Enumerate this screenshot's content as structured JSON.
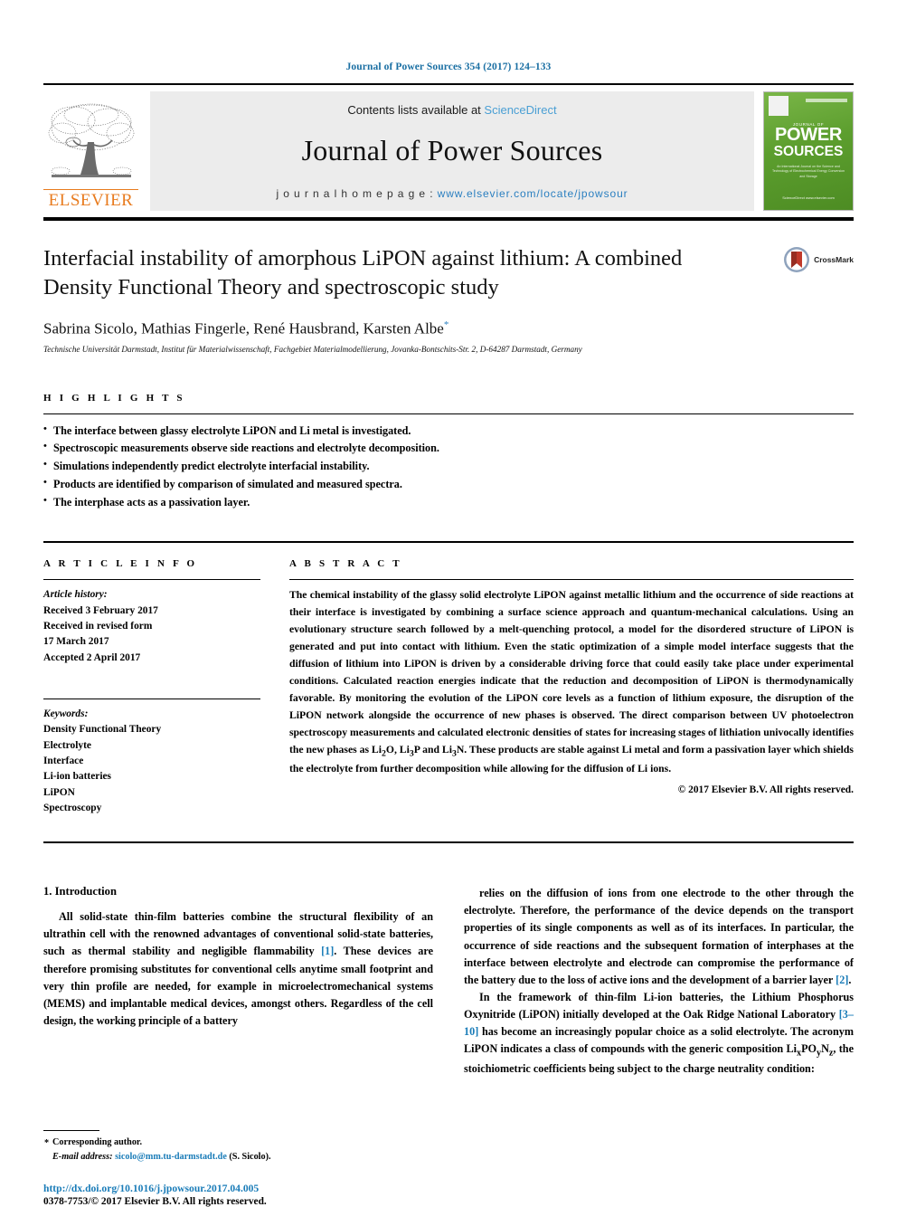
{
  "running_head": "Journal of Power Sources 354 (2017) 124–133",
  "masthead": {
    "contents_prefix": "Contents lists available at ",
    "sciencedirect": "ScienceDirect",
    "journal_name": "Journal of Power Sources",
    "homepage_prefix": "j o u r n a l   h o m e p a g e :  ",
    "homepage_url": "www.elsevier.com/locate/jpowsour",
    "publisher_logo_text": "ELSEVIER",
    "cover": {
      "kicker": "JOURNAL OF",
      "title_line1": "POWER",
      "title_line2": "SOURCES",
      "subtitle": "An International Journal on the Science and Technology of Electrochemical Energy Conversion and Storage",
      "footer": "ScienceDirect\nwww.elsevier.com"
    }
  },
  "article": {
    "title": "Interfacial instability of amorphous LiPON against lithium: A combined Density Functional Theory and spectroscopic study",
    "authors": "Sabrina Sicolo, Mathias Fingerle, René Hausbrand, Karsten Albe",
    "corresponding_marker": "*",
    "affiliation": "Technische Universität Darmstadt, Institut für Materialwissenschaft, Fachgebiet Materialmodellierung, Jovanka-Bontschits-Str. 2, D-64287 Darmstadt, Germany",
    "crossmark_label": "CrossMark"
  },
  "highlights": {
    "heading": "H I G H L I G H T S",
    "items": [
      "The interface between glassy electrolyte LiPON and Li metal is investigated.",
      "Spectroscopic measurements observe side reactions and electrolyte decomposition.",
      "Simulations independently predict electrolyte interfacial instability.",
      "Products are identified by comparison of simulated and measured spectra.",
      "The interphase acts as a passivation layer."
    ]
  },
  "article_info": {
    "heading": "A R T I C L E   I N F O",
    "history_label": "Article history:",
    "history_lines": [
      "Received 3 February 2017",
      "Received in revised form",
      "17 March 2017",
      "Accepted 2 April 2017"
    ],
    "keywords_label": "Keywords:",
    "keywords": [
      "Density Functional Theory",
      "Electrolyte",
      "Interface",
      "Li-ion batteries",
      "LiPON",
      "Spectroscopy"
    ]
  },
  "abstract": {
    "heading": "A B S T R A C T",
    "text": "The chemical instability of the glassy solid electrolyte LiPON against metallic lithium and the occurrence of side reactions at their interface is investigated by combining a surface science approach and quantum-mechanical calculations. Using an evolutionary structure search followed by a melt-quenching protocol, a model for the disordered structure of LiPON is generated and put into contact with lithium. Even the static optimization of a simple model interface suggests that the diffusion of lithium into LiPON is driven by a considerable driving force that could easily take place under experimental conditions. Calculated reaction energies indicate that the reduction and decomposition of LiPON is thermodynamically favorable. By monitoring the evolution of the LiPON core levels as a function of lithium exposure, the disruption of the LiPON network alongside the occurrence of new phases is observed. The direct comparison between UV photoelectron spectroscopy measurements and calculated electronic densities of states for increasing stages of lithiation univocally identifies the new phases as Li2O, Li3P and Li3N. These products are stable against Li metal and form a passivation layer which shields the electrolyte from further decomposition while allowing for the diffusion of Li ions.",
    "copyright": "© 2017 Elsevier B.V. All rights reserved."
  },
  "body": {
    "section_number_title": "1.  Introduction",
    "left_paragraph": "All solid-state thin-film batteries combine the structural flexibility of an ultrathin cell with the renowned advantages of conventional solid-state batteries, such as thermal stability and negligible flammability [1]. These devices are therefore promising substitutes for conventional cells anytime small footprint and very thin profile are needed, for example in microelectromechanical systems (MEMS) and implantable medical devices, amongst others. Regardless of the cell design, the working principle of a battery",
    "right_paragraph_1": "relies on the diffusion of ions from one electrode to the other through the electrolyte. Therefore, the performance of the device depends on the transport properties of its single components as well as of its interfaces. In particular, the occurrence of side reactions and the subsequent formation of interphases at the interface between electrolyte and electrode can compromise the performance of the battery due to the loss of active ions and the development of a barrier layer [2].",
    "right_paragraph_2": "In the framework of thin-film Li-ion batteries, the Lithium Phosphorus Oxynitride (LiPON) initially developed at the Oak Ridge National Laboratory [3–10] has become an increasingly popular choice as a solid electrolyte. The acronym LiPON indicates a class of compounds with the generic composition LixPOyNz, the stoichiometric coefficients being subject to the charge neutrality condition:",
    "ref_1": "[1]",
    "ref_2": "[2]",
    "ref_3_10": "[3–10]"
  },
  "footer": {
    "corresponding_author": "Corresponding author.",
    "email_label": "E-mail address:",
    "email": "sicolo@mm.tu-darmstadt.de",
    "email_suffix": "(S. Sicolo).",
    "doi_url": "http://dx.doi.org/10.1016/j.jpowsour.2017.04.005",
    "issn_line": "0378-7753/© 2017 Elsevier B.V. All rights reserved."
  },
  "colors": {
    "link_blue": "#1a7cb8",
    "sciencedirect_blue": "#4a9fd4",
    "elsevier_orange": "#E87B1E",
    "cover_green": "#5c9e2e"
  }
}
